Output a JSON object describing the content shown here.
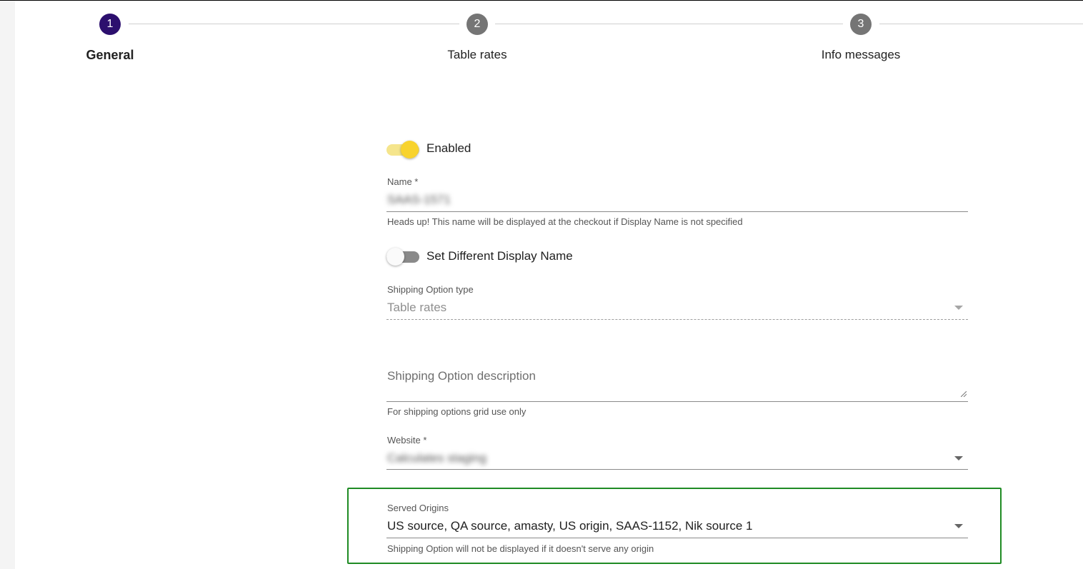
{
  "stepper": {
    "steps": [
      {
        "number": "1",
        "label": "General",
        "state": "active"
      },
      {
        "number": "2",
        "label": "Table rates",
        "state": "inactive"
      },
      {
        "number": "3",
        "label": "Info messages",
        "state": "inactive"
      }
    ]
  },
  "form": {
    "enabled": {
      "label": "Enabled",
      "checked": true
    },
    "name": {
      "label": "Name *",
      "value": "SAAS-1571",
      "value_blurred": true,
      "helper": "Heads up! This name will be displayed at the checkout if Display Name is not specified"
    },
    "display_name_toggle": {
      "label": "Set Different Display Name",
      "checked": false
    },
    "shipping_option_type": {
      "label": "Shipping Option type",
      "value": "Table rates",
      "disabled": true
    },
    "description": {
      "placeholder": "Shipping Option description",
      "helper": "For shipping options grid use only"
    },
    "website": {
      "label": "Website *",
      "value": "Calculates staging",
      "value_blurred": true
    },
    "served_origins": {
      "label": "Served Origins",
      "value": "US source, QA source, amasty, US origin, SAAS-1152, Nik source 1",
      "helper": "Shipping Option will not be displayed if it doesn't serve any origin",
      "highlighted": true
    }
  },
  "colors": {
    "step_active": "#2c0f6e",
    "step_inactive": "#757575",
    "toggle_on": "#f8d32e",
    "highlight_border": "#1f8b24"
  }
}
